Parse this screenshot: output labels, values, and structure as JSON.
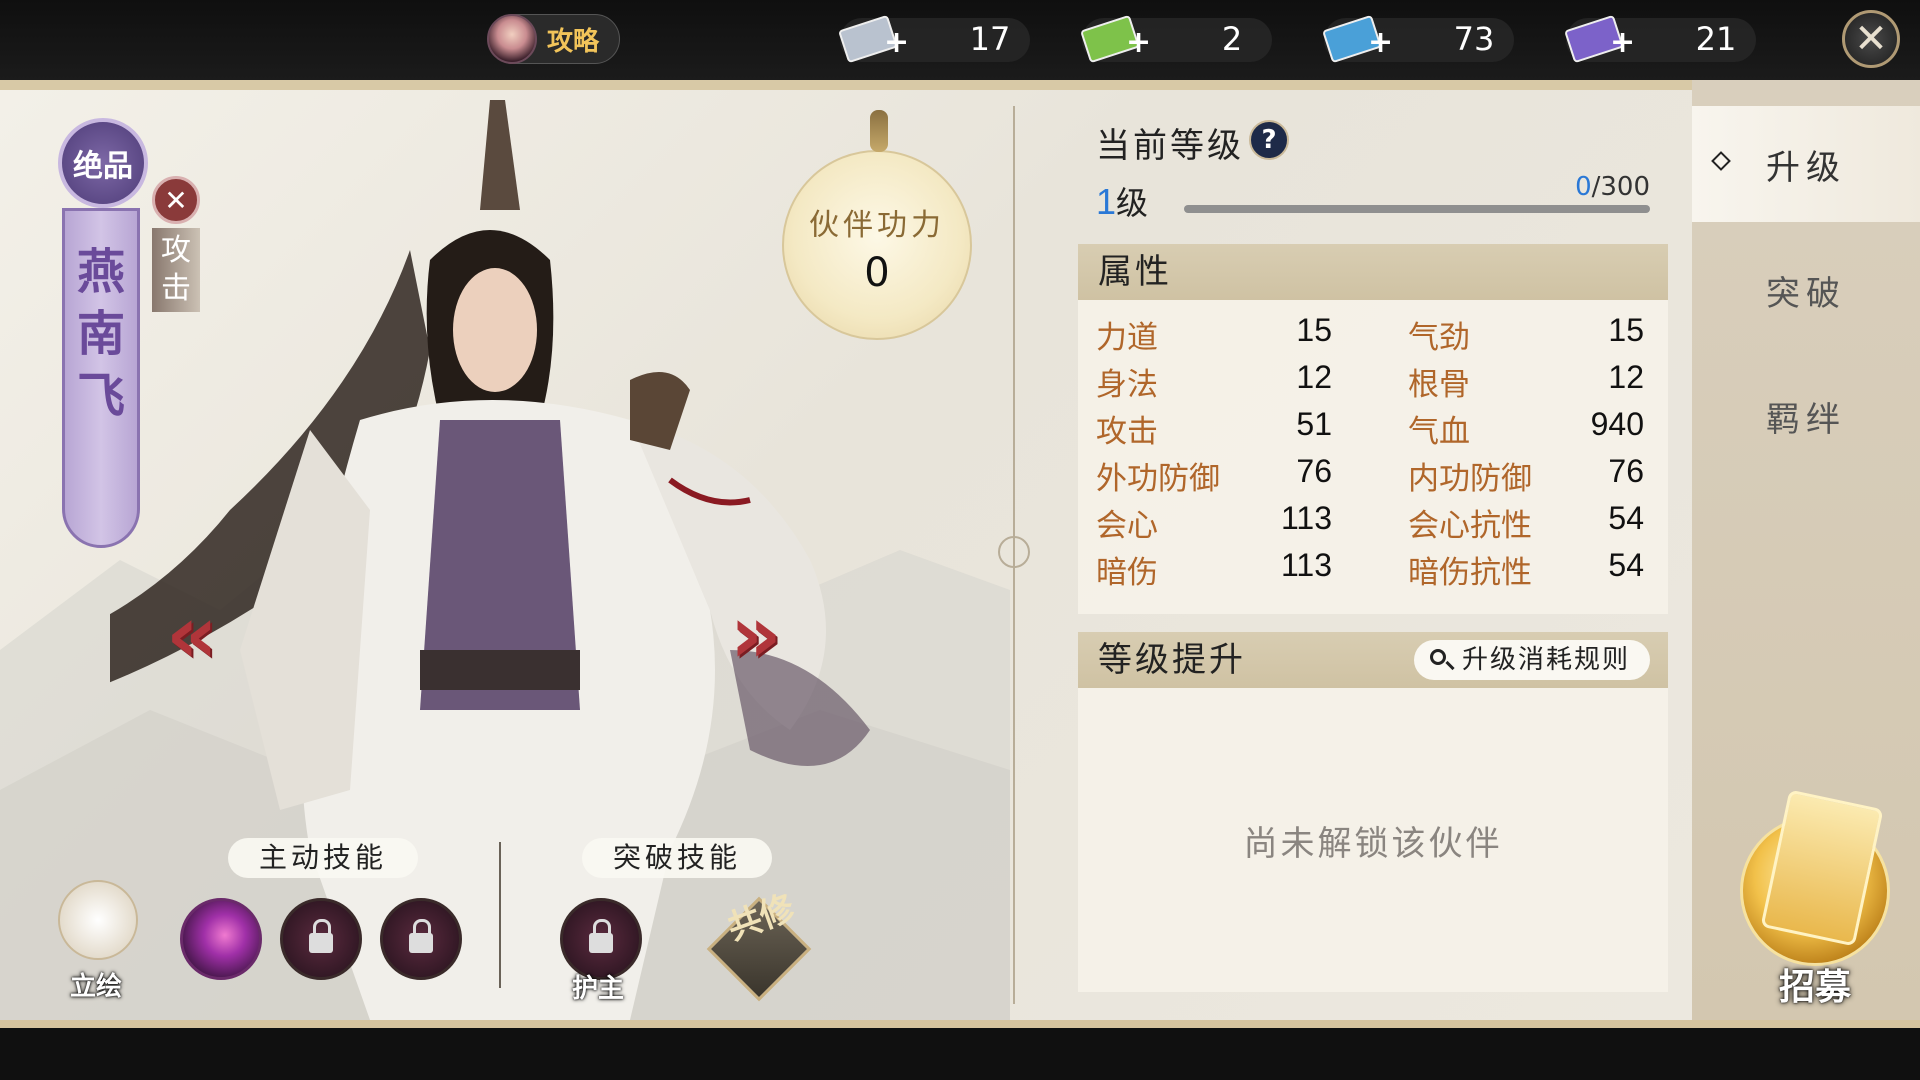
{
  "topbar": {
    "guide_label": "攻略",
    "resources": [
      {
        "value": "17",
        "color": "#b9c2cf",
        "icon": "silver-ticket-icon"
      },
      {
        "value": "2",
        "color": "#7ec24a",
        "icon": "green-ticket-icon"
      },
      {
        "value": "73",
        "color": "#4aa0d8",
        "icon": "blue-ticket-icon"
      },
      {
        "value": "21",
        "color": "#7c62c9",
        "icon": "purple-ticket-icon"
      }
    ],
    "close_glyph": "✕"
  },
  "character": {
    "rank": "绝品",
    "name_chars": [
      "燕",
      "南",
      "飞"
    ],
    "role_label_chars": [
      "攻",
      "击"
    ],
    "role_icon": "✕"
  },
  "power": {
    "title": "伙伴功力",
    "value": "0"
  },
  "nav": {
    "prev": "«",
    "next": "»"
  },
  "skills": {
    "active_header": "主动技能",
    "breakthrough_header": "突破技能",
    "portrait_label": "立绘",
    "guard_label": "护主",
    "gongxiu_label": "共修"
  },
  "level": {
    "title": "当前等级",
    "help": "?",
    "current": "1",
    "unit": "级",
    "exp_current": "0",
    "exp_max": "/300",
    "exp_fraction": 0
  },
  "attributes": {
    "header": "属性",
    "rows": [
      {
        "l_name": "力道",
        "l_val": "15",
        "r_name": "气劲",
        "r_val": "15"
      },
      {
        "l_name": "身法",
        "l_val": "12",
        "r_name": "根骨",
        "r_val": "12"
      },
      {
        "l_name": "攻击",
        "l_val": "51",
        "r_name": "气血",
        "r_val": "940"
      },
      {
        "l_name": "外功防御",
        "l_val": "76",
        "r_name": "内功防御",
        "r_val": "76"
      },
      {
        "l_name": "会心",
        "l_val": "113",
        "r_name": "会心抗性",
        "r_val": "54"
      },
      {
        "l_name": "暗伤",
        "l_val": "113",
        "r_name": "暗伤抗性",
        "r_val": "54"
      }
    ]
  },
  "upgrade": {
    "header": "等级提升",
    "rule_button": "升级消耗规则",
    "locked_message": "尚未解锁该伙伴"
  },
  "sidebar": {
    "tabs": [
      {
        "label": "升级",
        "active": true
      },
      {
        "label": "突破",
        "active": false
      },
      {
        "label": "羁绊",
        "active": false
      }
    ],
    "recruit_label": "招募"
  }
}
